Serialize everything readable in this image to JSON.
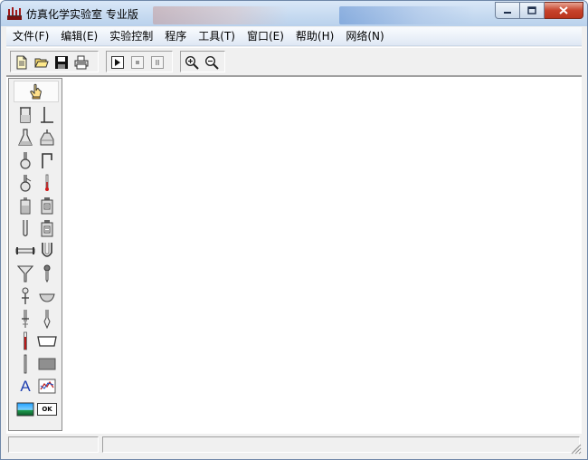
{
  "window": {
    "title": "仿真化学实验室 专业版"
  },
  "menu": [
    {
      "label": "文件(F)"
    },
    {
      "label": "编辑(E)"
    },
    {
      "label": "实验控制"
    },
    {
      "label": "程序"
    },
    {
      "label": "工具(T)"
    },
    {
      "label": "窗口(E)"
    },
    {
      "label": "帮助(H)"
    },
    {
      "label": "网络(N)"
    }
  ],
  "toolbar": {
    "groups": [
      [
        "new-file-icon",
        "open-folder-icon",
        "save-disk-icon",
        "print-icon"
      ],
      [
        "run-icon",
        "stop-icon",
        "pause-icon"
      ],
      [
        "zoom-in-icon",
        "zoom-out-icon"
      ]
    ]
  },
  "palette": {
    "selected": "pointer-hand-icon",
    "tools": [
      "beaker-icon",
      "stand-icon",
      "conical-flask-icon",
      "alcohol-lamp-icon",
      "round-flask-icon",
      "bent-tube-icon",
      "distilling-flask-icon",
      "thermometer-icon",
      "reagent-bottle-icon",
      "gas-bottle-icon",
      "test-tube-icon",
      "wide-bottle-icon",
      "glass-tube-icon",
      "u-tube-icon",
      "funnel-icon",
      "dropper-icon",
      "separatory-funnel-icon",
      "evaporating-dish-icon",
      "burette-icon",
      "pipette-icon",
      "thermometer-red-icon",
      "trough-icon",
      "glass-rod-icon",
      "plate-icon",
      "text-tool-icon",
      "chart-tool-icon",
      "image-tool-icon",
      "ok-button-tool-icon"
    ],
    "text_label": "A",
    "ok_label": "OK"
  },
  "status": {
    "pane1": "",
    "pane2": ""
  },
  "colors": {
    "titlebar": "#c6d9ef",
    "close": "#c7432c",
    "face": "#f0f0f0",
    "text_tool": "#1f3fb0"
  }
}
